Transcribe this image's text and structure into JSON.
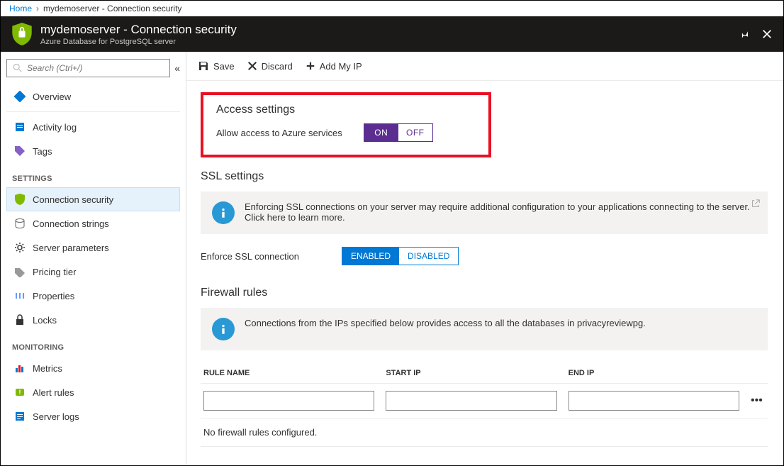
{
  "breadcrumb": {
    "home": "Home",
    "current": "mydemoserver - Connection security"
  },
  "header": {
    "title": "mydemoserver - Connection security",
    "subtitle": "Azure Database for PostgreSQL server"
  },
  "search": {
    "placeholder": "Search (Ctrl+/)"
  },
  "nav": {
    "top": [
      {
        "label": "Overview"
      },
      {
        "label": "Activity log"
      },
      {
        "label": "Tags"
      }
    ],
    "settings_title": "SETTINGS",
    "settings": [
      {
        "label": "Connection security",
        "active": true
      },
      {
        "label": "Connection strings"
      },
      {
        "label": "Server parameters"
      },
      {
        "label": "Pricing tier"
      },
      {
        "label": "Properties"
      },
      {
        "label": "Locks"
      }
    ],
    "monitoring_title": "MONITORING",
    "monitoring": [
      {
        "label": "Metrics"
      },
      {
        "label": "Alert rules"
      },
      {
        "label": "Server logs"
      }
    ]
  },
  "toolbar": {
    "save": "Save",
    "discard": "Discard",
    "addip": "Add My IP"
  },
  "access": {
    "title": "Access settings",
    "label": "Allow access to Azure services",
    "on": "ON",
    "off": "OFF"
  },
  "ssl": {
    "title": "SSL settings",
    "info": "Enforcing SSL connections on your server may require additional configuration to your applications connecting to the server.  Click here to learn more.",
    "enforce_label": "Enforce SSL connection",
    "enabled": "ENABLED",
    "disabled": "DISABLED"
  },
  "firewall": {
    "title": "Firewall rules",
    "info": "Connections from the IPs specified below provides access to all the databases in privacyreviewpg.",
    "col_rule": "RULE NAME",
    "col_start": "START IP",
    "col_end": "END IP",
    "empty": "No firewall rules configured."
  }
}
